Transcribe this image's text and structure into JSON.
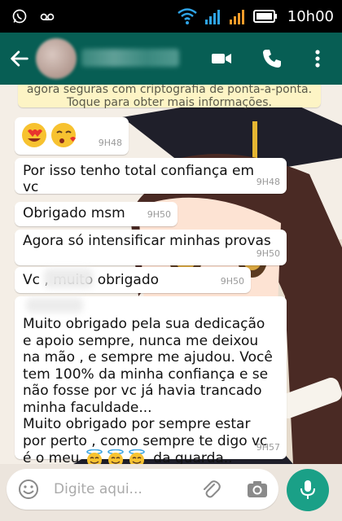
{
  "status_bar": {
    "time": "10h00"
  },
  "chat": {
    "system_notice": {
      "line1": "agora seguras com criptografia de ponta-a-ponta.",
      "line2": "Toque para obter mais informações."
    },
    "messages": [
      {
        "text": "",
        "time": "9H48"
      },
      {
        "text": "Por isso tenho total confiança em vc",
        "time": "9H48"
      },
      {
        "text": "Obrigado msm",
        "time": "9H50"
      },
      {
        "text": "Agora só intensificar minhas provas",
        "time": "9H50"
      },
      {
        "text": "Vc          , muito obrigado",
        "time": "9H50"
      },
      {
        "lines": [
          "Muito obrigado pela sua dedicação",
          "e apoio sempre, nunca me deixou",
          "na mão , e sempre me ajudou. Você",
          "tem 100% da minha confiança e se",
          "não fosse por vc já havia trancado",
          "minha faculdade...",
          "Muito obrigado por sempre estar",
          "por perto , como sempre te digo vc",
          "é o meu",
          "da guarda.."
        ],
        "time": "9H57"
      }
    ]
  },
  "input": {
    "placeholder": "Digite aqui..."
  },
  "colors": {
    "header": "#075e54",
    "mic": "#1aa087",
    "notice": "#fdf4c5"
  },
  "icons": [
    "whatsapp-icon",
    "voicemail-icon",
    "wifi-icon",
    "signal-icon",
    "battery-icon",
    "back-arrow-icon",
    "video-call-icon",
    "phone-icon",
    "more-options-icon",
    "emoji-icon",
    "attach-icon",
    "camera-icon",
    "mic-icon"
  ]
}
